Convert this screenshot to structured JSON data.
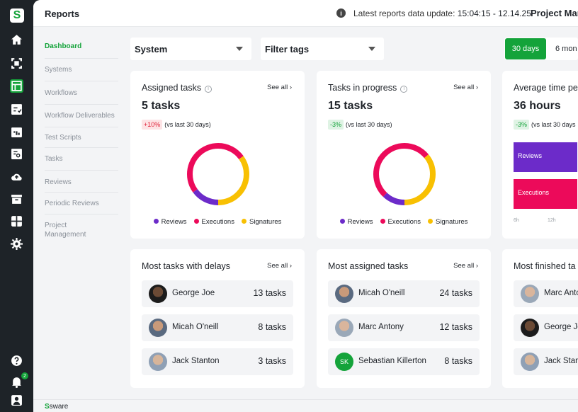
{
  "app": {
    "logo_letter": "S",
    "title": "Reports",
    "update_label": "Latest reports data update:",
    "update_value": "15:04:15 - 12.14.25",
    "project_label": "Project Man"
  },
  "rail": {
    "icons": [
      "home-icon",
      "scan-icon",
      "reports-icon",
      "checklist-icon",
      "calendar-icon",
      "search-doc-icon",
      "cloud-upload-icon",
      "archive-icon",
      "apps-icon",
      "settings-icon"
    ],
    "bottom_icons": [
      "help-icon",
      "notifications-icon",
      "user-icon"
    ],
    "notification_count": "2"
  },
  "sidenav": {
    "items": [
      {
        "label": "Dashboard",
        "active": true
      },
      {
        "label": "Systems"
      },
      {
        "label": "Workflows"
      },
      {
        "label": "Workflow Deliverables"
      },
      {
        "label": "Test Scripts"
      },
      {
        "label": "Tasks"
      },
      {
        "label": "Reviews"
      },
      {
        "label": "Periodic Reviews"
      },
      {
        "label": "Project Management"
      }
    ]
  },
  "filters": {
    "system": "System",
    "tags": "Filter tags",
    "range_active": "30 days",
    "range_other": "6 mon"
  },
  "see_all": "See all ›",
  "colors": {
    "reviews": "#6c2bc9",
    "executions": "#ec0a5a",
    "signatures": "#f8c002",
    "accent": "#14a33a"
  },
  "legend": [
    "Reviews",
    "Executions",
    "Signatures"
  ],
  "assigned": {
    "title": "Assigned tasks",
    "value": "5 tasks",
    "delta": "+10%",
    "delta_note": "(vs last 30 days)",
    "shares": {
      "reviews": 0.15,
      "executions": 0.5,
      "signatures": 0.35
    }
  },
  "progress": {
    "title": "Tasks in progress",
    "value": "15 tasks",
    "delta": "-3%",
    "delta_note": "(vs last 30 days)",
    "shares": {
      "reviews": 0.12,
      "executions": 0.52,
      "signatures": 0.36
    }
  },
  "avgtime": {
    "title": "Average time pe",
    "value": "36 hours",
    "delta": "-3%",
    "delta_note": "(vs last 30 days",
    "bars": [
      "Reviews",
      "Executions"
    ],
    "axis": [
      "6h",
      "12h"
    ]
  },
  "delays": {
    "title": "Most tasks with delays",
    "rows": [
      {
        "name": "George Joe",
        "count": "13 tasks"
      },
      {
        "name": "Micah O'neill",
        "count": "8 tasks"
      },
      {
        "name": "Jack Stanton",
        "count": "3 tasks"
      }
    ]
  },
  "most_assigned": {
    "title": "Most assigned tasks",
    "rows": [
      {
        "name": "Micah O'neill",
        "count": "24 tasks"
      },
      {
        "name": "Marc Antony",
        "count": "12 tasks"
      },
      {
        "name": "Sebastian Killerton",
        "count": "8 tasks",
        "initials": "SK"
      }
    ]
  },
  "finished": {
    "title": "Most finished ta",
    "rows": [
      {
        "name": "Marc Anto"
      },
      {
        "name": "George Jo"
      },
      {
        "name": "Jack Stan"
      }
    ]
  },
  "footer": {
    "brand_mark": "S",
    "brand_text": "sware"
  }
}
